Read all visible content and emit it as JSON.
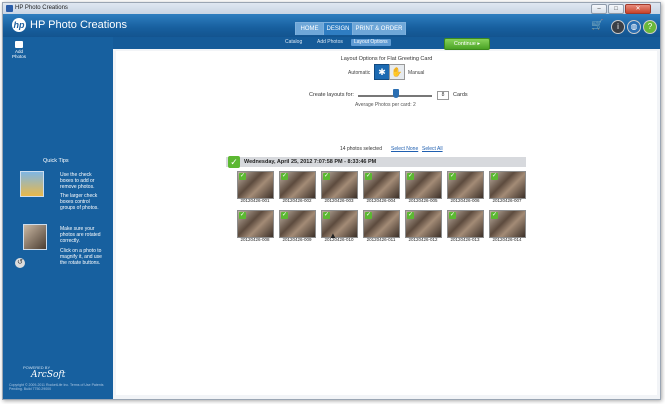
{
  "window": {
    "title": "HP Photo Creations",
    "controls": [
      "–",
      "□",
      "✕"
    ]
  },
  "header": {
    "logo": "hp",
    "app_title": "HP Photo Creations",
    "tabs": [
      {
        "label": "HOME",
        "active": false
      },
      {
        "label": "DESIGN",
        "active": true
      },
      {
        "label": "PRINT & ORDER",
        "active": false
      }
    ],
    "icons": [
      "cart-icon",
      "info-icon",
      "globe-icon",
      "help-icon"
    ]
  },
  "subnav": {
    "items": [
      "Catalog",
      "Add Photos",
      "Layout Options"
    ],
    "active": "Layout Options",
    "continue_label": "Continue"
  },
  "sidebar": {
    "add_photos_label": "Add Photos",
    "quick_tips_title": "Quick Tips",
    "tips": [
      "Use the check boxes to add or remove photos.",
      "The larger check boxes control groups of photos.",
      "Make sure your photos are rotated correctly.",
      "Click on a photo to magnify it, and use the rotate buttons."
    ],
    "powered_by": "POWERED BY",
    "signature": "ArcSoft",
    "copyright": "Copyright © 2009-2011 RocketLife Inc.  Terms of Use  Patents Pending. Build 7750.29000"
  },
  "layout": {
    "title": "Layout Options for Flat Greeting Card",
    "automatic_label": "Automatic",
    "manual_label": "Manual",
    "create_layouts_label": "Create layouts for:",
    "cards_value": "8",
    "cards_label": "Cards",
    "avg_text": "Average Photos per card: 2"
  },
  "selection": {
    "count_text": "14 photos selected",
    "select_none": "Select None",
    "select_all": "Select All"
  },
  "group": {
    "label": "Wednesday, April 25, 2012 7:07:58 PM - 8:33:46 PM"
  },
  "photos": [
    "20120426-001",
    "20120426-002",
    "20120426-003",
    "20120426-004",
    "20120426-005",
    "20120426-006",
    "20120426-007",
    "20120426-008",
    "20120426-009",
    "20120426-010",
    "20120426-011",
    "20120426-012",
    "20120426-013",
    "20120426-014"
  ],
  "colors": {
    "brand_blue": "#17609f",
    "continue_green": "#4aa325",
    "check_green": "#5cb832"
  }
}
